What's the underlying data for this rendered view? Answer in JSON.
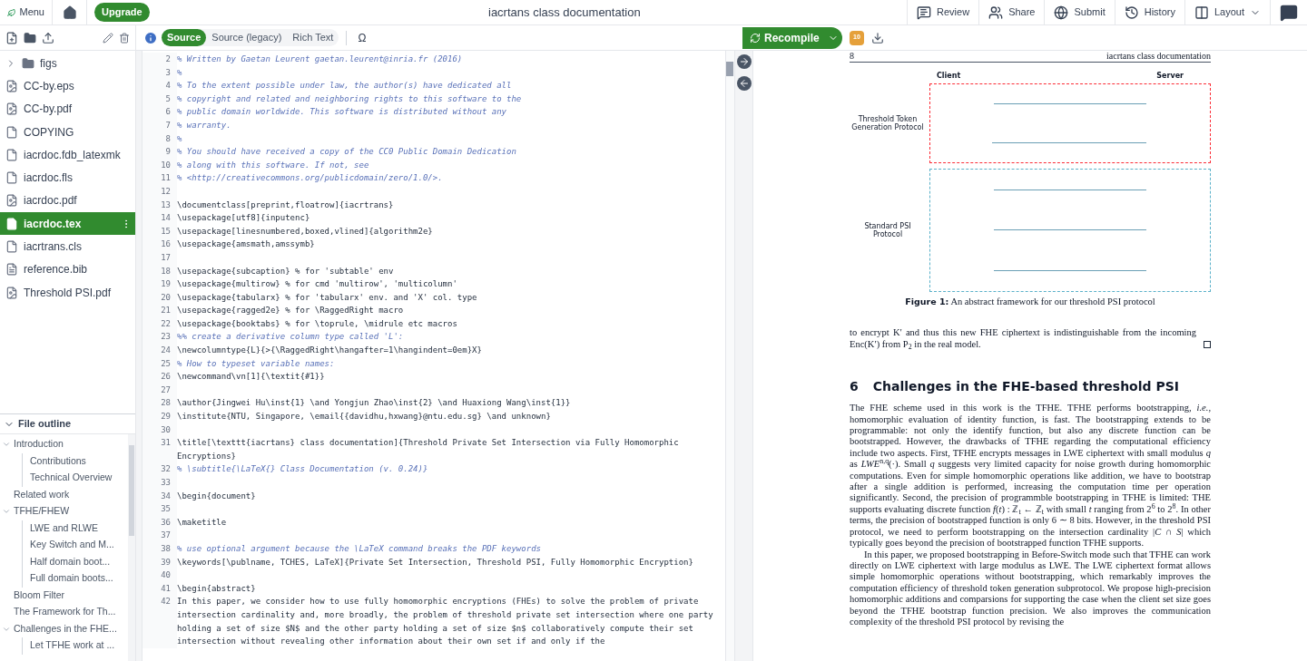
{
  "topbar": {
    "menu": "Menu",
    "upgrade": "Upgrade",
    "title": "iacrtans class documentation",
    "actions": [
      {
        "kind": "review",
        "label": "Review"
      },
      {
        "kind": "share",
        "label": "Share"
      },
      {
        "kind": "submit",
        "label": "Submit"
      },
      {
        "kind": "history",
        "label": "History"
      },
      {
        "kind": "layout",
        "label": "Layout"
      },
      {
        "kind": "chat"
      }
    ]
  },
  "files": [
    {
      "name": "figs",
      "kind": "folder",
      "selected": false
    },
    {
      "name": "CC-by.eps",
      "kind": "image",
      "selected": false
    },
    {
      "name": "CC-by.pdf",
      "kind": "image",
      "selected": false
    },
    {
      "name": "COPYING",
      "kind": "file",
      "selected": false
    },
    {
      "name": "iacrdoc.fdb_latexmk",
      "kind": "file",
      "selected": false
    },
    {
      "name": "iacrdoc.fls",
      "kind": "file",
      "selected": false
    },
    {
      "name": "iacrdoc.pdf",
      "kind": "image",
      "selected": false
    },
    {
      "name": "iacrdoc.tex",
      "kind": "file",
      "selected": true
    },
    {
      "name": "iacrtrans.cls",
      "kind": "file",
      "selected": false
    },
    {
      "name": "reference.bib",
      "kind": "bib",
      "selected": false
    },
    {
      "name": "Threshold PSI.pdf",
      "kind": "image",
      "selected": false
    }
  ],
  "outline": {
    "title": "File outline",
    "expanded": true,
    "items": [
      {
        "label": "Introduction",
        "expanded": true,
        "children": [
          {
            "label": "Contributions"
          },
          {
            "label": "Technical Overview"
          }
        ]
      },
      {
        "label": "Related work"
      },
      {
        "label": "TFHE/FHEW",
        "expanded": true,
        "children": [
          {
            "label": "LWE and RLWE"
          },
          {
            "label": "Key Switch and M..."
          },
          {
            "label": "Half domain boot..."
          },
          {
            "label": "Full domain boots..."
          }
        ]
      },
      {
        "label": "Bloom Filter"
      },
      {
        "label": "The Framework for Th..."
      },
      {
        "label": "Challenges in the FHE...",
        "expanded": true,
        "children": [
          {
            "label": "Let TFHE work at ..."
          }
        ]
      }
    ]
  },
  "editor": {
    "modes": [
      {
        "label": "Source",
        "selected": true
      },
      {
        "label": "Source (legacy)",
        "selected": false
      },
      {
        "label": "Rich Text",
        "selected": false
      }
    ],
    "symbol": "Ω",
    "lines": [
      {
        "n": "2",
        "kind": "comment",
        "text": "% Written by Gaetan Leurent gaetan.leurent@inria.fr (2016)"
      },
      {
        "n": "3",
        "kind": "comment",
        "text": "%"
      },
      {
        "n": "4",
        "kind": "comment",
        "text": "% To the extent possible under law, the author(s) have dedicated all"
      },
      {
        "n": "5",
        "kind": "comment",
        "text": "% copyright and related and neighboring rights to this software to the"
      },
      {
        "n": "6",
        "kind": "comment",
        "text": "% public domain worldwide. This software is distributed without any"
      },
      {
        "n": "7",
        "kind": "comment",
        "text": "% warranty."
      },
      {
        "n": "8",
        "kind": "comment",
        "text": "%"
      },
      {
        "n": "9",
        "kind": "comment",
        "text": "% You should have received a copy of the CC0 Public Domain Dedication"
      },
      {
        "n": "10",
        "kind": "comment",
        "text": "% along with this software. If not, see"
      },
      {
        "n": "11",
        "kind": "comment",
        "text": "% <http://creativecommons.org/publicdomain/zero/1.0/>."
      },
      {
        "n": "12",
        "kind": "blank"
      },
      {
        "n": "13",
        "kind": "code",
        "text": "\\documentclass[preprint,floatrow]{iacrtrans}"
      },
      {
        "n": "14",
        "kind": "code",
        "text": "\\usepackage[utf8]{inputenc}"
      },
      {
        "n": "15",
        "kind": "code",
        "text": "\\usepackage[linesnumbered,boxed,vlined]{algorithm2e}"
      },
      {
        "n": "16",
        "kind": "code",
        "text": "\\usepackage{amsmath,amssymb}"
      },
      {
        "n": "17",
        "kind": "blank"
      },
      {
        "n": "18",
        "kind": "code",
        "text": "\\usepackage{subcaption} % for 'subtable' env"
      },
      {
        "n": "19",
        "kind": "code",
        "text": "\\usepackage{multirow} % for cmd 'multirow', 'multicolumn'"
      },
      {
        "n": "20",
        "kind": "code",
        "text": "\\usepackage{tabularx} % for 'tabularx' env. and 'X' col. type"
      },
      {
        "n": "21",
        "kind": "code",
        "text": "\\usepackage{ragged2e} % for \\RaggedRight macro"
      },
      {
        "n": "22",
        "kind": "code",
        "text": "\\usepackage{booktabs} % for \\toprule, \\midrule etc macros"
      },
      {
        "n": "23",
        "kind": "comment",
        "text": "%% create a derivative column type called 'L':"
      },
      {
        "n": "24",
        "kind": "code",
        "text": "\\newcolumntype{L}{>{\\RaggedRight\\hangafter=1\\hangindent=0em}X}"
      },
      {
        "n": "25",
        "kind": "comment",
        "text": "% How to typeset variable names:"
      },
      {
        "n": "26",
        "kind": "code",
        "text": "\\newcommand\\vn[1]{\\textit{#1}}"
      },
      {
        "n": "27",
        "kind": "blank"
      },
      {
        "n": "28",
        "kind": "code",
        "text": "\\author{Jingwei Hu\\inst{1} \\and Yongjun Zhao\\inst{2} \\and Huaxiong Wang\\inst{1}}"
      },
      {
        "n": "29",
        "kind": "code",
        "text": "\\institute{NTU, Singapore, \\email{{davidhu,hxwang}@ntu.edu.sg} \\and unknown}"
      },
      {
        "n": "30",
        "kind": "blank"
      },
      {
        "n": "31",
        "kind": "code",
        "text": "\\title[\\texttt{iacrtans} class documentation]{Threshold Private Set Intersection via Fully Homomorphic Encryptions}"
      },
      {
        "n": "32",
        "kind": "comment",
        "text": "% \\subtitle{\\LaTeX{} Class Documentation (v. 0.24)}"
      },
      {
        "n": "33",
        "kind": "blank"
      },
      {
        "n": "34",
        "kind": "code",
        "text": "\\begin{document}"
      },
      {
        "n": "35",
        "kind": "blank"
      },
      {
        "n": "36",
        "kind": "code",
        "text": "\\maketitle"
      },
      {
        "n": "37",
        "kind": "blank"
      },
      {
        "n": "38",
        "kind": "comment",
        "text": "% use optional argument because the \\LaTeX command breaks the PDF keywords"
      },
      {
        "n": "39",
        "kind": "code",
        "text": "\\keywords[\\publname, TCHES, LaTeX]{Private Set Intersection, Threshold PSI, Fully Homomorphic Encryption}"
      },
      {
        "n": "40",
        "kind": "blank"
      },
      {
        "n": "41",
        "kind": "code",
        "text": "\\begin{abstract}"
      },
      {
        "n": "42",
        "kind": "code",
        "text": "In this paper, we consider how to use fully homomorphic encryptions (FHEs) to solve the problem of private intersection cardinality and, more broadly, the problem of threshold private set intersection where one party holding a set of size $N$ and the other party holding a set of size $n$ collaboratively compute their set intersection without revealing other information about their own set if and only if the"
      }
    ]
  },
  "preview": {
    "recompile": "Recompile",
    "log_count": "10",
    "page_number": "8",
    "running_head": "iacrtans class documentation",
    "figure": {
      "client": "Client",
      "server": "Server",
      "stage_1": "Threshold Token Generation Protocol",
      "stage_2": "Standard PSI Protocol",
      "caption_label": "Figure 1:",
      "caption": "An abstract framework for our threshold PSI protocol"
    },
    "proof_end": "to encrypt K′ and thus this new FHE ciphertext is indistinguishable from the incoming Enc(K′) from P$_{2}$ in the real model.",
    "section_number": "6",
    "section_title": "Challenges in the FHE-based threshold PSI",
    "paragraphs": [
      "The FHE scheme used in this work is the TFHE. TFHE performs bootstrapping, *i.e.*, homomorphic evaluation of identity function, is fast. The bootstrapping extends to be programmable: not only the identify function, but also any discrete function can be bootstrapped. However, the drawbacks of TFHE regarding the computational efficiency include two aspects. First, TFHE encrypts messages in LWE ciphertext with small modulus *q* as *LWE*$^{n,q}$(·). Small *q* suggests very limited capacity for noise growth during homomorphic computations. Even for simple homomorphic operations like addition, we have to bootstrap after a single addition is performed, increasing the computation time per operation significantly. Second, the precision of programmble bootstrapping in TFHE is limited: THE supports evaluating discrete function *f*(*t*) : ℤ$_{t}$ ← ℤ$_{t}$ with small *t* ranging from 2$^{6}$ to 2$^{8}$. In other terms, the precision of bootstrapped function is only 6 ∼ 8 bits. However, in the threshold PSI protocol, we need to perform bootstrapping on the intersection cardinality |*C* ∩ *S*| which typically goes beyond the precision of bootstrapped function TFHE supports.",
      "In this paper, we proposed bootstrapping in Before-Switch mode such that TFHE can work directly on LWE ciphertext with large modulus as LWE. The LWE ciphertext format allows simple homomorphic operations without bootstrapping, which remarkably improves the computation efficiency of threshold token generation subprotocol. We propose high-precision homomorphic additions and comparsions for supporting the case when the client set size goes beyond the TFHE bootstrap function precision. We also improves the communication complexity of the threshold PSI protocol by revising the"
    ]
  }
}
